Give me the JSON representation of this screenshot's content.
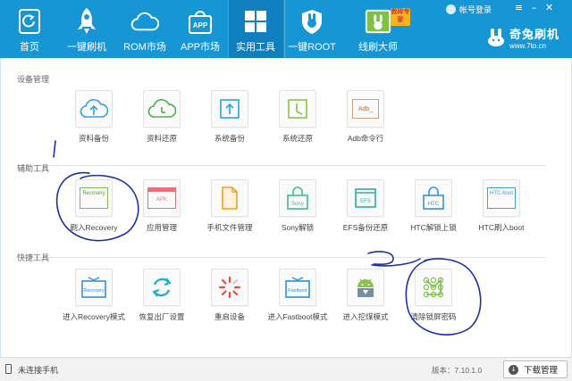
{
  "nav": {
    "items": [
      {
        "label": "首页",
        "icon": "home-icon"
      },
      {
        "label": "一键刷机",
        "icon": "rocket-icon"
      },
      {
        "label": "ROM市场",
        "icon": "cloud-icon"
      },
      {
        "label": "APP市场",
        "icon": "app-bag-icon"
      },
      {
        "label": "实用工具",
        "icon": "grid-icon"
      },
      {
        "label": "一键ROOT",
        "icon": "shield-rabbit-icon"
      },
      {
        "label": "线刷大师",
        "icon": "rabbit-master-icon"
      }
    ],
    "active_index": 4,
    "badge": "救砖专家"
  },
  "account": {
    "label": "帐号登录"
  },
  "brand": {
    "name": "奇兔刷机",
    "url": "www.7to.cn"
  },
  "sections": {
    "device": {
      "title": "设备管理",
      "tools": [
        {
          "label": "资料备份",
          "icon": "cloud-upload-icon",
          "color": "#3aa0dc"
        },
        {
          "label": "资料还原",
          "icon": "cloud-clock-icon",
          "color": "#4caf50"
        },
        {
          "label": "系统备份",
          "icon": "upload-box-icon",
          "color": "#26a8c9"
        },
        {
          "label": "系统还原",
          "icon": "restore-box-icon",
          "color": "#8bc34a"
        },
        {
          "label": "Adb命令行",
          "icon": "adb-icon",
          "color": "#c9a27e",
          "icon_text": "Adb_"
        }
      ]
    },
    "assist": {
      "title": "辅助工具",
      "tools": [
        {
          "label": "刷入Recovery",
          "icon": "recovery-flash-icon",
          "color": "#7cbf4a",
          "icon_text": "Recovery"
        },
        {
          "label": "应用管理",
          "icon": "apk-icon",
          "color": "#e9707a",
          "icon_text": "APK"
        },
        {
          "label": "手机文件管理",
          "icon": "file-icon",
          "color": "#f0a020"
        },
        {
          "label": "Sony解锁",
          "icon": "sony-lock-icon",
          "color": "#3dbb8f",
          "icon_text": "Sony"
        },
        {
          "label": "EFS备份还原",
          "icon": "efs-icon",
          "color": "#2ab09c",
          "icon_text": "EFS"
        },
        {
          "label": "HTC解锁上锁",
          "icon": "htc-lock-icon",
          "color": "#3a8fd8",
          "icon_text": "HTC"
        },
        {
          "label": "HTC刷入boot",
          "icon": "htc-boot-icon",
          "color": "#3aa0dc",
          "icon_text": "HTC-boot"
        }
      ]
    },
    "quick": {
      "title": "快捷工具",
      "tools": [
        {
          "label": "进入Recovery模式",
          "icon": "recovery-mode-icon",
          "color": "#3a8fd8",
          "icon_text": "Recovery"
        },
        {
          "label": "恢复出厂设置",
          "icon": "factory-reset-icon",
          "color": "#1fb0c9"
        },
        {
          "label": "重启设备",
          "icon": "reboot-icon",
          "color": "#e84a4a"
        },
        {
          "label": "进入Fastboot模式",
          "icon": "fastboot-icon",
          "color": "#2d8fd8",
          "icon_text": "Fastboot"
        },
        {
          "label": "进入挖煤模式",
          "icon": "android-icon",
          "color": "#8bc34a"
        },
        {
          "label": "清除锁屏密码",
          "icon": "pattern-lock-icon",
          "color": "#7cbf4a"
        }
      ]
    }
  },
  "status": {
    "device": "未连接手机",
    "version": "版本：7.10.1.0",
    "download": "下载管理"
  }
}
